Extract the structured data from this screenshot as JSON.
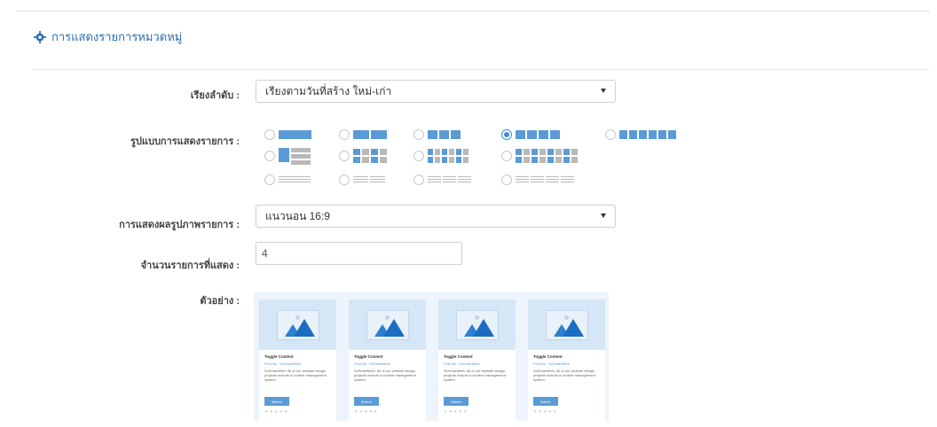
{
  "header": {
    "title": "การแสดงรายการหมวดหมู่",
    "icon": "gear-icon"
  },
  "sort": {
    "label": "เรียงลำดับ :",
    "value": "เรียงตามวันที่สร้าง ใหม่-เก่า"
  },
  "layout": {
    "label": "รูปแบบการแสดงรายการ :",
    "selected_option": "list-4-columns"
  },
  "cover": {
    "label": "การแสดงผลรูปภาพรายการ :",
    "value": "แนวนอน 16:9"
  },
  "count": {
    "label": "จำนวนรายการที่แสดง :",
    "value": "4"
  },
  "preview": {
    "label": "ตัวอย่าง :",
    "cards": [
      {
        "title": "Toggle Content",
        "by": "Post By : SoSmartWeb",
        "desc": "SoSmartWeb, All of our website design projects include a content management system.",
        "button": "Button",
        "stars": "★★★★★"
      },
      {
        "title": "Toggle Content",
        "by": "Post By : SoSmartWeb",
        "desc": "SoSmartWeb, All of our website design projects include a content management system.",
        "button": "Button",
        "stars": "★★★★★"
      },
      {
        "title": "Toggle Content",
        "by": "Post By : SoSmartWeb",
        "desc": "SoSmartWeb, All of our website design projects include a content management system.",
        "button": "Button",
        "stars": "★★★★★"
      },
      {
        "title": "Toggle Content",
        "by": "Post By : SoSmartWeb",
        "desc": "SoSmartWeb, All of our website design projects include a content management system.",
        "button": "Button",
        "stars": "★★★★★"
      }
    ]
  },
  "colors": {
    "accent": "#5b9bd5",
    "title": "#2a6fb0"
  }
}
